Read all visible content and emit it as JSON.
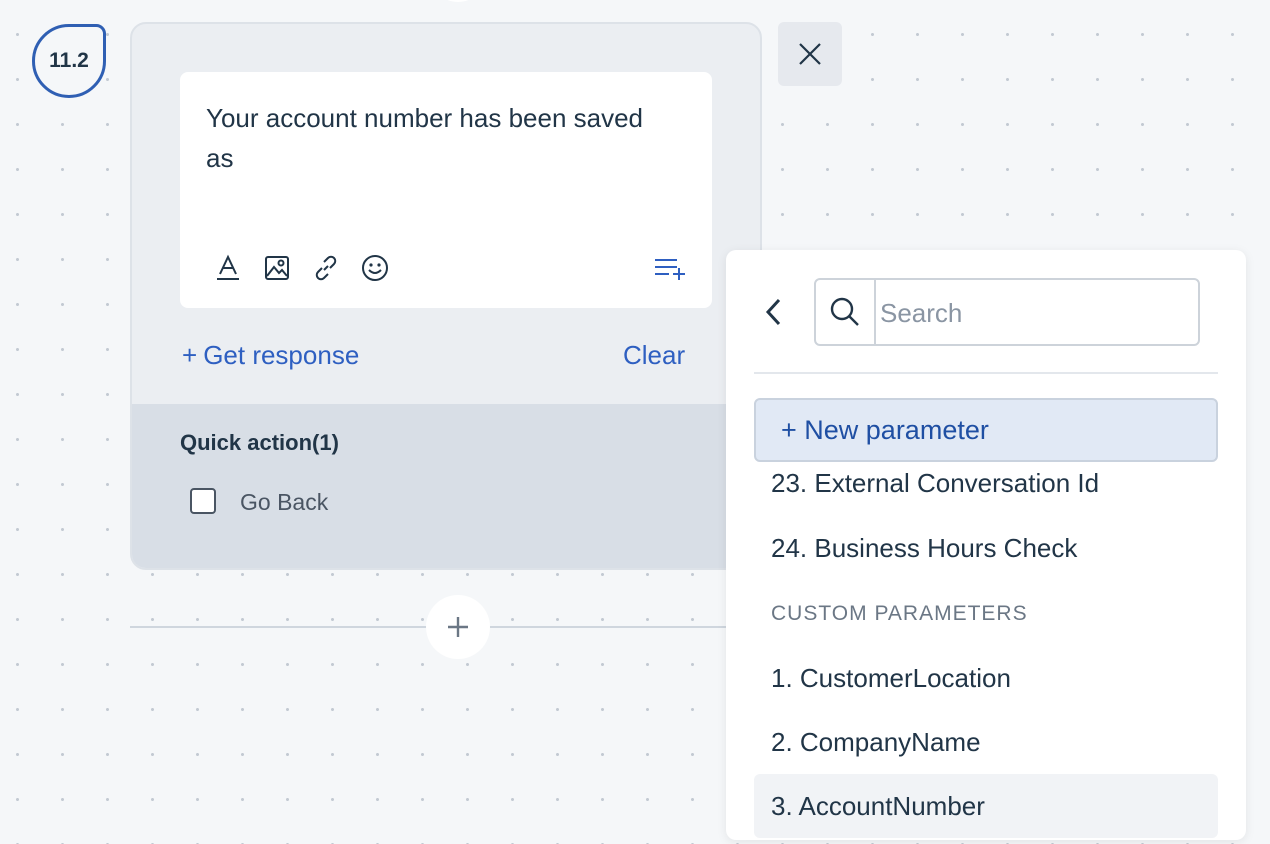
{
  "step": {
    "number": "11.2"
  },
  "message": {
    "text": "Your account number has been saved as",
    "tools": [
      "text-format-icon",
      "image-icon",
      "link-icon",
      "emoji-icon",
      "insert-variable-icon"
    ]
  },
  "actions": {
    "get_response": "Get response",
    "clear": "Clear"
  },
  "quick_action": {
    "title": "Quick action(1)",
    "items": [
      {
        "label": "Go Back",
        "checked": false
      }
    ]
  },
  "parameter_panel": {
    "search_placeholder": "Search",
    "new_parameter": "+ New parameter",
    "system_params": [
      "23. External Conversation Id",
      "24. Business Hours Check"
    ],
    "custom_heading": "CUSTOM PARAMETERS",
    "custom_params": [
      "1. CustomerLocation",
      "2. CompanyName",
      "3. AccountNumber"
    ]
  },
  "colors": {
    "accent": "#2e5fc1",
    "badge_border": "#2f5fb3",
    "text": "#213547"
  }
}
